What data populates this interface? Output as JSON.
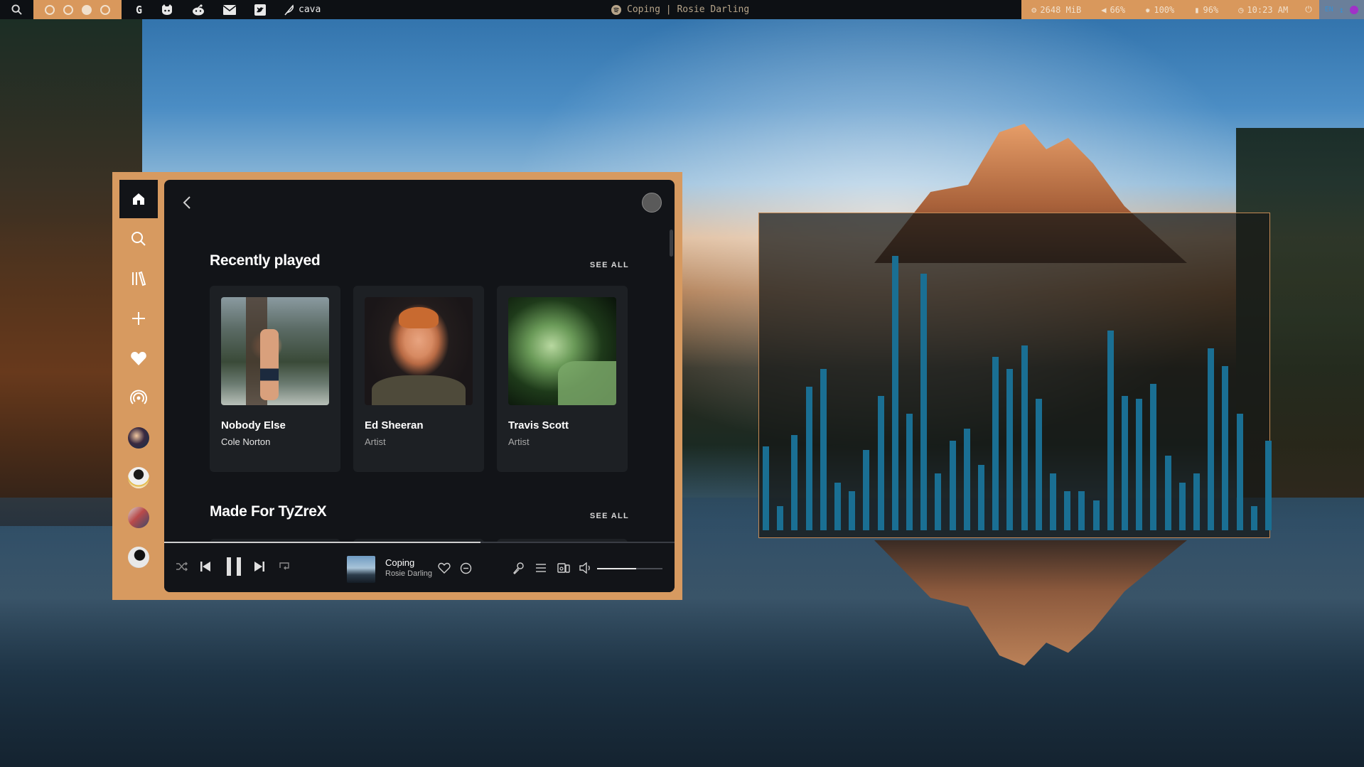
{
  "topbar": {
    "workspaces": [
      "ws1",
      "ws2",
      "ws3",
      "ws4"
    ],
    "active_workspace_index": 2,
    "apps": [
      {
        "icon": "google-icon",
        "label": ""
      },
      {
        "icon": "github-icon",
        "label": ""
      },
      {
        "icon": "reddit-icon",
        "label": ""
      },
      {
        "icon": "mail-icon",
        "label": ""
      },
      {
        "icon": "twitter-icon",
        "label": ""
      },
      {
        "icon": "feather-icon",
        "label": "cava"
      }
    ],
    "now_playing": "Coping | Rosie Darling",
    "stats": {
      "memory": "2648 MiB",
      "volume": "66%",
      "brightness": "100%",
      "battery": "96%",
      "clock": "10:23 AM"
    }
  },
  "spotify": {
    "sidebar": [
      {
        "name": "home",
        "icon": "home-icon"
      },
      {
        "name": "search",
        "icon": "search-icon"
      },
      {
        "name": "library",
        "icon": "library-icon"
      },
      {
        "name": "create-playlist",
        "icon": "plus-icon"
      },
      {
        "name": "liked-songs",
        "icon": "heart-icon"
      },
      {
        "name": "podcasts",
        "icon": "podcast-icon"
      },
      {
        "name": "playlist-1",
        "icon": "avatar"
      },
      {
        "name": "playlist-2",
        "icon": "avatar"
      },
      {
        "name": "playlist-3",
        "icon": "avatar"
      },
      {
        "name": "playlist-4",
        "icon": "avatar"
      }
    ],
    "sections": [
      {
        "title": "Recently played",
        "see_all": "SEE ALL",
        "items": [
          {
            "title": "Nobody Else",
            "subtitle": "Cole Norton"
          },
          {
            "title": "Ed Sheeran",
            "subtitle": "Artist"
          },
          {
            "title": "Travis Scott",
            "subtitle": "Artist"
          }
        ]
      },
      {
        "title": "Made For TyZreX",
        "see_all": "SEE ALL"
      }
    ],
    "player": {
      "track": "Coping",
      "artist": "Rosie Darling",
      "progress_fraction": 0.62,
      "volume_fraction": 0.6
    },
    "colors": {
      "frame": "#d79a60",
      "main_bg": "#121418",
      "card_bg": "#1d2024",
      "cava_bar": "#1a6f93"
    }
  },
  "cava": {
    "levels": [
      0.28,
      0.08,
      0.32,
      0.48,
      0.54,
      0.16,
      0.13,
      0.27,
      0.45,
      0.92,
      0.39,
      0.86,
      0.19,
      0.3,
      0.34,
      0.22,
      0.58,
      0.54,
      0.62,
      0.44,
      0.19,
      0.13,
      0.13,
      0.1,
      0.67,
      0.45,
      0.44,
      0.49,
      0.25,
      0.16,
      0.19,
      0.61,
      0.55,
      0.39,
      0.08,
      0.3
    ]
  }
}
